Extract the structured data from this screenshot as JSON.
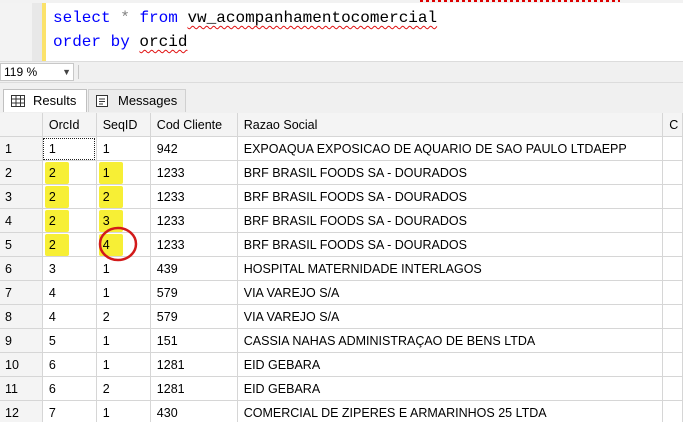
{
  "editor": {
    "line1": {
      "kw1": "select",
      "op": "*",
      "kw2": "from",
      "view": "vw_acompanhamentocomercial"
    },
    "line2": {
      "kw": "order by",
      "field": "orcid"
    }
  },
  "zoom": {
    "value": "119 %"
  },
  "tabs": [
    {
      "label": "Results",
      "active": true,
      "icon": "grid-icon"
    },
    {
      "label": "Messages",
      "active": false,
      "icon": "messages-icon"
    }
  ],
  "grid": {
    "columns": [
      "",
      "OrcId",
      "SeqID",
      "Cod Cliente",
      "Razao Social",
      "C"
    ],
    "rows": [
      {
        "n": "1",
        "orc": "1",
        "seq": "1",
        "cod": "942",
        "razao": "EXPOAQUA EXPOSICAO DE AQUARIO DE SAO PAULO LTDAEPP"
      },
      {
        "n": "2",
        "orc": "2",
        "seq": "1",
        "cod": "1233",
        "razao": "BRF BRASIL FOODS SA - DOURADOS"
      },
      {
        "n": "3",
        "orc": "2",
        "seq": "2",
        "cod": "1233",
        "razao": "BRF BRASIL FOODS SA - DOURADOS"
      },
      {
        "n": "4",
        "orc": "2",
        "seq": "3",
        "cod": "1233",
        "razao": "BRF BRASIL FOODS SA - DOURADOS"
      },
      {
        "n": "5",
        "orc": "2",
        "seq": "4",
        "cod": "1233",
        "razao": "BRF BRASIL FOODS SA - DOURADOS"
      },
      {
        "n": "6",
        "orc": "3",
        "seq": "1",
        "cod": "439",
        "razao": "HOSPITAL MATERNIDADE INTERLAGOS"
      },
      {
        "n": "7",
        "orc": "4",
        "seq": "1",
        "cod": "579",
        "razao": "VIA VAREJO S/A"
      },
      {
        "n": "8",
        "orc": "4",
        "seq": "2",
        "cod": "579",
        "razao": "VIA VAREJO S/A"
      },
      {
        "n": "9",
        "orc": "5",
        "seq": "1",
        "cod": "151",
        "razao": "CASSIA NAHAS ADMINISTRAÇAO DE BENS LTDA"
      },
      {
        "n": "10",
        "orc": "6",
        "seq": "1",
        "cod": "1281",
        "razao": "EID GEBARA"
      },
      {
        "n": "11",
        "orc": "6",
        "seq": "2",
        "cod": "1281",
        "razao": "EID GEBARA"
      },
      {
        "n": "12",
        "orc": "7",
        "seq": "1",
        "cod": "430",
        "razao": "COMERCIAL DE ZIPERES E ARMARINHOS 25 LTDA"
      }
    ],
    "highlight_color": "#f7ee2a",
    "circle_color": "#d21a1a"
  }
}
